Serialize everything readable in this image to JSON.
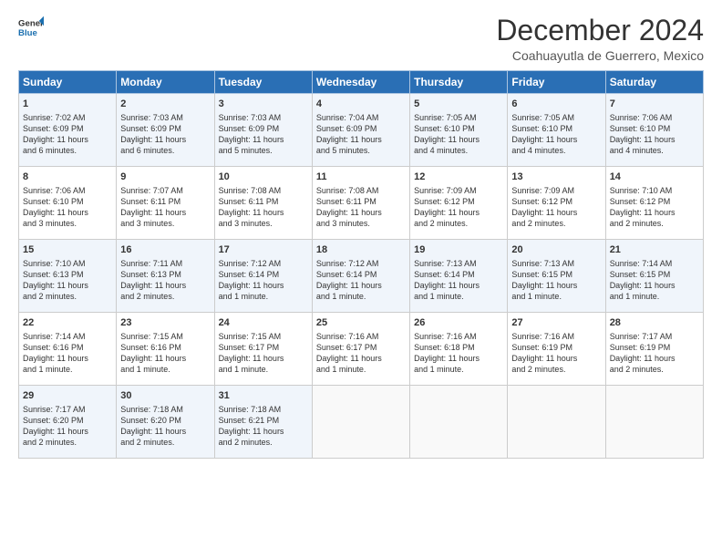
{
  "logo": {
    "line1": "General",
    "line2": "Blue"
  },
  "title": "December 2024",
  "subtitle": "Coahuayutla de Guerrero, Mexico",
  "days_of_week": [
    "Sunday",
    "Monday",
    "Tuesday",
    "Wednesday",
    "Thursday",
    "Friday",
    "Saturday"
  ],
  "weeks": [
    [
      {
        "day": "1",
        "lines": [
          "Sunrise: 7:02 AM",
          "Sunset: 6:09 PM",
          "Daylight: 11 hours",
          "and 6 minutes."
        ]
      },
      {
        "day": "2",
        "lines": [
          "Sunrise: 7:03 AM",
          "Sunset: 6:09 PM",
          "Daylight: 11 hours",
          "and 6 minutes."
        ]
      },
      {
        "day": "3",
        "lines": [
          "Sunrise: 7:03 AM",
          "Sunset: 6:09 PM",
          "Daylight: 11 hours",
          "and 5 minutes."
        ]
      },
      {
        "day": "4",
        "lines": [
          "Sunrise: 7:04 AM",
          "Sunset: 6:09 PM",
          "Daylight: 11 hours",
          "and 5 minutes."
        ]
      },
      {
        "day": "5",
        "lines": [
          "Sunrise: 7:05 AM",
          "Sunset: 6:10 PM",
          "Daylight: 11 hours",
          "and 4 minutes."
        ]
      },
      {
        "day": "6",
        "lines": [
          "Sunrise: 7:05 AM",
          "Sunset: 6:10 PM",
          "Daylight: 11 hours",
          "and 4 minutes."
        ]
      },
      {
        "day": "7",
        "lines": [
          "Sunrise: 7:06 AM",
          "Sunset: 6:10 PM",
          "Daylight: 11 hours",
          "and 4 minutes."
        ]
      }
    ],
    [
      {
        "day": "8",
        "lines": [
          "Sunrise: 7:06 AM",
          "Sunset: 6:10 PM",
          "Daylight: 11 hours",
          "and 3 minutes."
        ]
      },
      {
        "day": "9",
        "lines": [
          "Sunrise: 7:07 AM",
          "Sunset: 6:11 PM",
          "Daylight: 11 hours",
          "and 3 minutes."
        ]
      },
      {
        "day": "10",
        "lines": [
          "Sunrise: 7:08 AM",
          "Sunset: 6:11 PM",
          "Daylight: 11 hours",
          "and 3 minutes."
        ]
      },
      {
        "day": "11",
        "lines": [
          "Sunrise: 7:08 AM",
          "Sunset: 6:11 PM",
          "Daylight: 11 hours",
          "and 3 minutes."
        ]
      },
      {
        "day": "12",
        "lines": [
          "Sunrise: 7:09 AM",
          "Sunset: 6:12 PM",
          "Daylight: 11 hours",
          "and 2 minutes."
        ]
      },
      {
        "day": "13",
        "lines": [
          "Sunrise: 7:09 AM",
          "Sunset: 6:12 PM",
          "Daylight: 11 hours",
          "and 2 minutes."
        ]
      },
      {
        "day": "14",
        "lines": [
          "Sunrise: 7:10 AM",
          "Sunset: 6:12 PM",
          "Daylight: 11 hours",
          "and 2 minutes."
        ]
      }
    ],
    [
      {
        "day": "15",
        "lines": [
          "Sunrise: 7:10 AM",
          "Sunset: 6:13 PM",
          "Daylight: 11 hours",
          "and 2 minutes."
        ]
      },
      {
        "day": "16",
        "lines": [
          "Sunrise: 7:11 AM",
          "Sunset: 6:13 PM",
          "Daylight: 11 hours",
          "and 2 minutes."
        ]
      },
      {
        "day": "17",
        "lines": [
          "Sunrise: 7:12 AM",
          "Sunset: 6:14 PM",
          "Daylight: 11 hours",
          "and 1 minute."
        ]
      },
      {
        "day": "18",
        "lines": [
          "Sunrise: 7:12 AM",
          "Sunset: 6:14 PM",
          "Daylight: 11 hours",
          "and 1 minute."
        ]
      },
      {
        "day": "19",
        "lines": [
          "Sunrise: 7:13 AM",
          "Sunset: 6:14 PM",
          "Daylight: 11 hours",
          "and 1 minute."
        ]
      },
      {
        "day": "20",
        "lines": [
          "Sunrise: 7:13 AM",
          "Sunset: 6:15 PM",
          "Daylight: 11 hours",
          "and 1 minute."
        ]
      },
      {
        "day": "21",
        "lines": [
          "Sunrise: 7:14 AM",
          "Sunset: 6:15 PM",
          "Daylight: 11 hours",
          "and 1 minute."
        ]
      }
    ],
    [
      {
        "day": "22",
        "lines": [
          "Sunrise: 7:14 AM",
          "Sunset: 6:16 PM",
          "Daylight: 11 hours",
          "and 1 minute."
        ]
      },
      {
        "day": "23",
        "lines": [
          "Sunrise: 7:15 AM",
          "Sunset: 6:16 PM",
          "Daylight: 11 hours",
          "and 1 minute."
        ]
      },
      {
        "day": "24",
        "lines": [
          "Sunrise: 7:15 AM",
          "Sunset: 6:17 PM",
          "Daylight: 11 hours",
          "and 1 minute."
        ]
      },
      {
        "day": "25",
        "lines": [
          "Sunrise: 7:16 AM",
          "Sunset: 6:17 PM",
          "Daylight: 11 hours",
          "and 1 minute."
        ]
      },
      {
        "day": "26",
        "lines": [
          "Sunrise: 7:16 AM",
          "Sunset: 6:18 PM",
          "Daylight: 11 hours",
          "and 1 minute."
        ]
      },
      {
        "day": "27",
        "lines": [
          "Sunrise: 7:16 AM",
          "Sunset: 6:19 PM",
          "Daylight: 11 hours",
          "and 2 minutes."
        ]
      },
      {
        "day": "28",
        "lines": [
          "Sunrise: 7:17 AM",
          "Sunset: 6:19 PM",
          "Daylight: 11 hours",
          "and 2 minutes."
        ]
      }
    ],
    [
      {
        "day": "29",
        "lines": [
          "Sunrise: 7:17 AM",
          "Sunset: 6:20 PM",
          "Daylight: 11 hours",
          "and 2 minutes."
        ]
      },
      {
        "day": "30",
        "lines": [
          "Sunrise: 7:18 AM",
          "Sunset: 6:20 PM",
          "Daylight: 11 hours",
          "and 2 minutes."
        ]
      },
      {
        "day": "31",
        "lines": [
          "Sunrise: 7:18 AM",
          "Sunset: 6:21 PM",
          "Daylight: 11 hours",
          "and 2 minutes."
        ]
      },
      {
        "day": "",
        "lines": []
      },
      {
        "day": "",
        "lines": []
      },
      {
        "day": "",
        "lines": []
      },
      {
        "day": "",
        "lines": []
      }
    ]
  ]
}
